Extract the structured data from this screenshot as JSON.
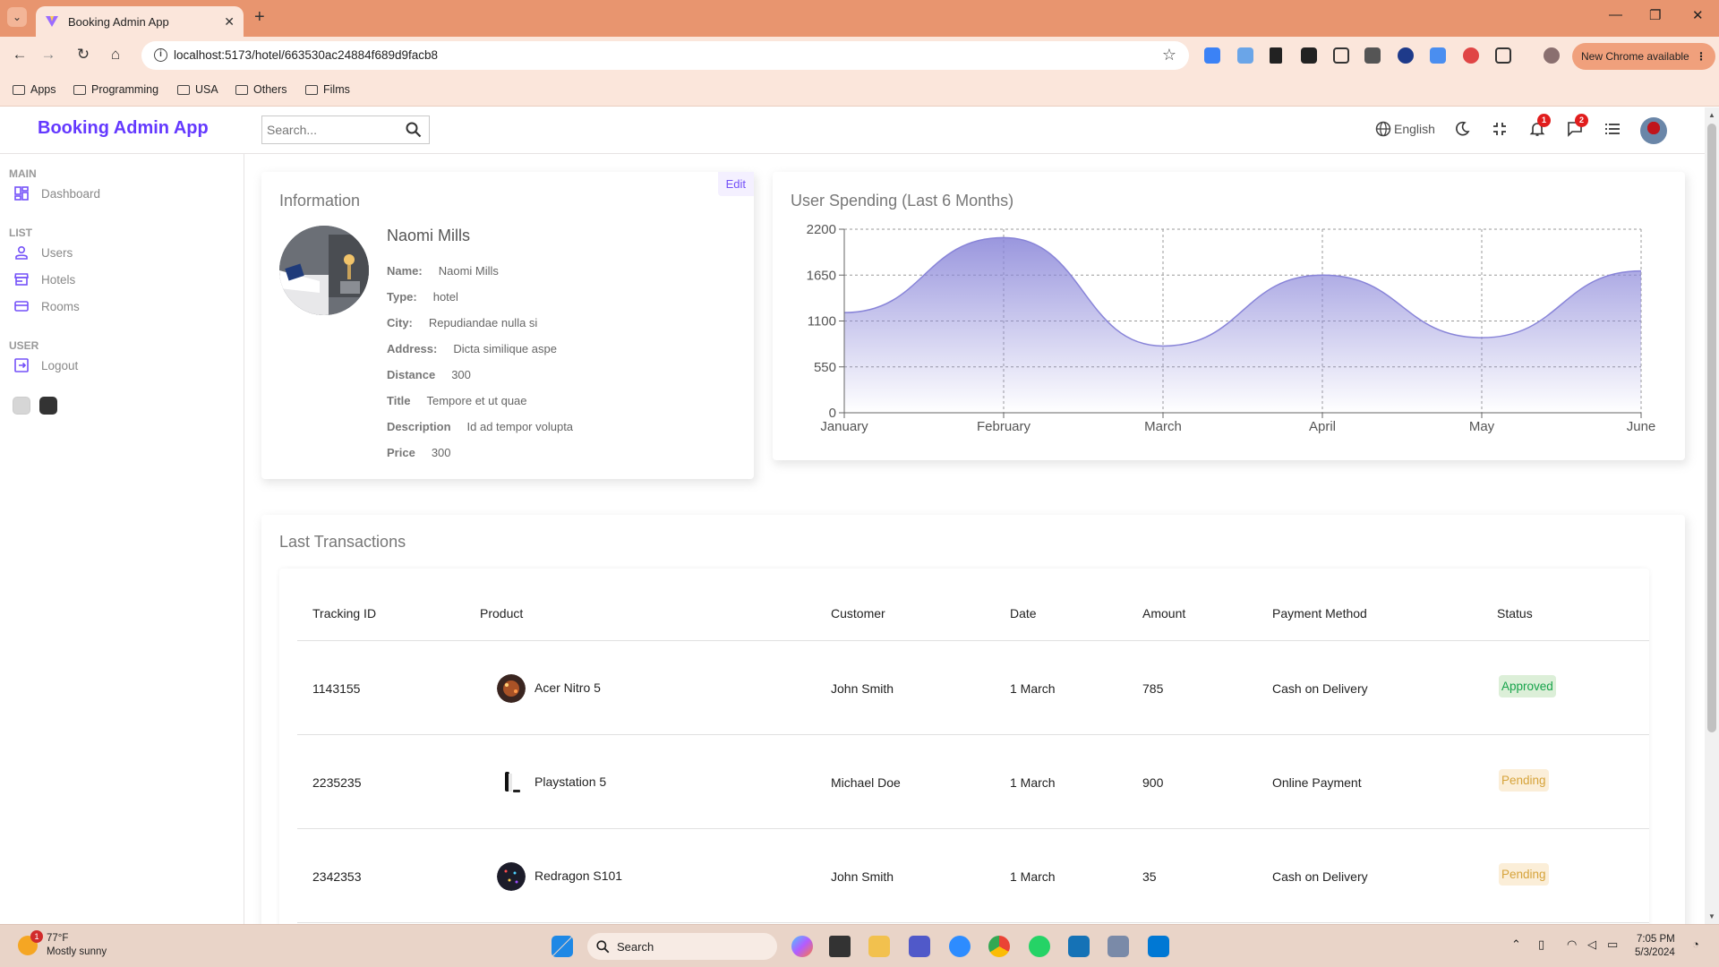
{
  "browser": {
    "tab_title": "Booking Admin App",
    "url": "localhost:5173/hotel/663530ac24884f689d9facb8",
    "new_chrome": "New Chrome available",
    "bookmarks": [
      "Apps",
      "Programming",
      "USA",
      "Others",
      "Films"
    ]
  },
  "app": {
    "logo": "Booking Admin App",
    "search_placeholder": "Search...",
    "language": "English",
    "notifications_count": "1",
    "messages_count": "2"
  },
  "sidebar": {
    "sections": [
      {
        "title": "MAIN",
        "items": [
          {
            "label": "Dashboard",
            "icon": "dashboard-icon"
          }
        ]
      },
      {
        "title": "LIST",
        "items": [
          {
            "label": "Users",
            "icon": "person-icon"
          },
          {
            "label": "Hotels",
            "icon": "store-icon"
          },
          {
            "label": "Rooms",
            "icon": "credit-card-icon"
          }
        ]
      },
      {
        "title": "USER",
        "items": [
          {
            "label": "Logout",
            "icon": "exit-icon"
          }
        ]
      }
    ]
  },
  "info": {
    "title": "Information",
    "edit": "Edit",
    "name": "Naomi Mills",
    "details": [
      {
        "key": "Name:",
        "value": "Naomi Mills"
      },
      {
        "key": "Type:",
        "value": "hotel"
      },
      {
        "key": "City:",
        "value": "Repudiandae nulla si"
      },
      {
        "key": "Address:",
        "value": "Dicta similique aspe"
      },
      {
        "key": "Distance",
        "value": "300"
      },
      {
        "key": "Title",
        "value": "Tempore et ut quae"
      },
      {
        "key": "Description",
        "value": "Id ad tempor volupta"
      },
      {
        "key": "Price",
        "value": "300"
      }
    ]
  },
  "chart_title": "User Spending (Last 6 Months)",
  "chart_data": {
    "type": "area",
    "title": "User Spending (Last 6 Months)",
    "categories": [
      "January",
      "February",
      "March",
      "April",
      "May",
      "June"
    ],
    "values": [
      1200,
      2100,
      800,
      1650,
      900,
      1700
    ],
    "ylim": [
      0,
      2200
    ],
    "yticks": [
      "0",
      "550",
      "1100",
      "1650",
      "2200"
    ],
    "grid": true,
    "color": "#8884d8"
  },
  "transactions": {
    "title": "Last Transactions",
    "columns": [
      "Tracking ID",
      "Product",
      "Customer",
      "Date",
      "Amount",
      "Payment Method",
      "Status"
    ],
    "rows": [
      {
        "id": "1143155",
        "product": "Acer Nitro 5",
        "customer": "John Smith",
        "date": "1 March",
        "amount": "785",
        "method": "Cash on Delivery",
        "status": "Approved"
      },
      {
        "id": "2235235",
        "product": "Playstation 5",
        "customer": "Michael Doe",
        "date": "1 March",
        "amount": "900",
        "method": "Online Payment",
        "status": "Pending"
      },
      {
        "id": "2342353",
        "product": "Redragon S101",
        "customer": "John Smith",
        "date": "1 March",
        "amount": "35",
        "method": "Cash on Delivery",
        "status": "Pending"
      }
    ]
  },
  "taskbar": {
    "temperature": "77°F",
    "weather": "Mostly sunny",
    "weather_badge": "1",
    "search": "Search",
    "time": "7:05 PM",
    "date": "5/3/2024"
  }
}
